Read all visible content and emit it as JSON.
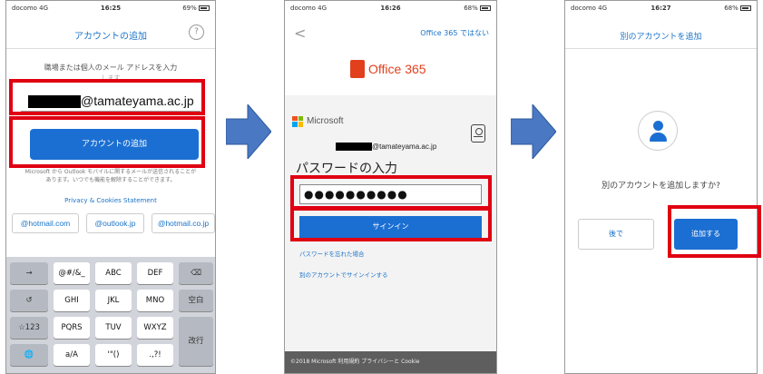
{
  "colors": {
    "accent": "#1b6fd2",
    "highlight": "#e00012",
    "arrow": "#4a78c2",
    "office_red": "#e2401d"
  },
  "screen1": {
    "status": {
      "carrier": "docomo 4G",
      "time": "16:25",
      "battery": "69%"
    },
    "nav_title": "アカウントの追加",
    "help_icon": "?",
    "instruction": "職場または個人のメール アドレスを入力",
    "instruction_sub": "します",
    "email_domain": "@tamateyama.ac.jp",
    "add_button": "アカウントの追加",
    "notice": "Microsoft から Outlook モバイルに関するメールが送信されることがあります。いつでも機能を解除することができます。",
    "privacy_link": "Privacy & Cookies Statement",
    "chips": [
      "@hotmail.com",
      "@outlook.jp",
      "@hotmail.co.jp"
    ],
    "keyboard": {
      "row1": [
        "→",
        "@#/&_",
        "ABC",
        "DEF",
        "⌫"
      ],
      "row2": [
        "↺",
        "GHI",
        "JKL",
        "MNO",
        "空白"
      ],
      "row3": [
        "☆123",
        "PQRS",
        "TUV",
        "WXYZ",
        "改行"
      ],
      "row4": [
        "🌐",
        "a/A",
        "'\"()",
        ".,?!"
      ]
    }
  },
  "screen2": {
    "status": {
      "carrier": "docomo 4G",
      "time": "16:26",
      "battery": "68%"
    },
    "back_icon": "<",
    "not_office_link": "Office 365 ではない",
    "office_logo_text": "Office 365",
    "microsoft_label": "Microsoft",
    "account_domain": "@tamateyama.ac.jp",
    "password_title": "パスワードの入力",
    "password_value": "●●●●●●●●●●",
    "signin_button": "サインイン",
    "forgot_link": "パスワードを忘れた場合",
    "other_account_link": "別のアカウントでサインインする",
    "footer": "©2018 Microsoft   利用規約   プライバシーと Cookie"
  },
  "screen3": {
    "status": {
      "carrier": "docomo 4G",
      "time": "16:27",
      "battery": "68%"
    },
    "nav_title": "別のアカウントを追加",
    "question": "別のアカウントを追加しますか?",
    "later_button": "後で",
    "add_button": "追加する"
  }
}
